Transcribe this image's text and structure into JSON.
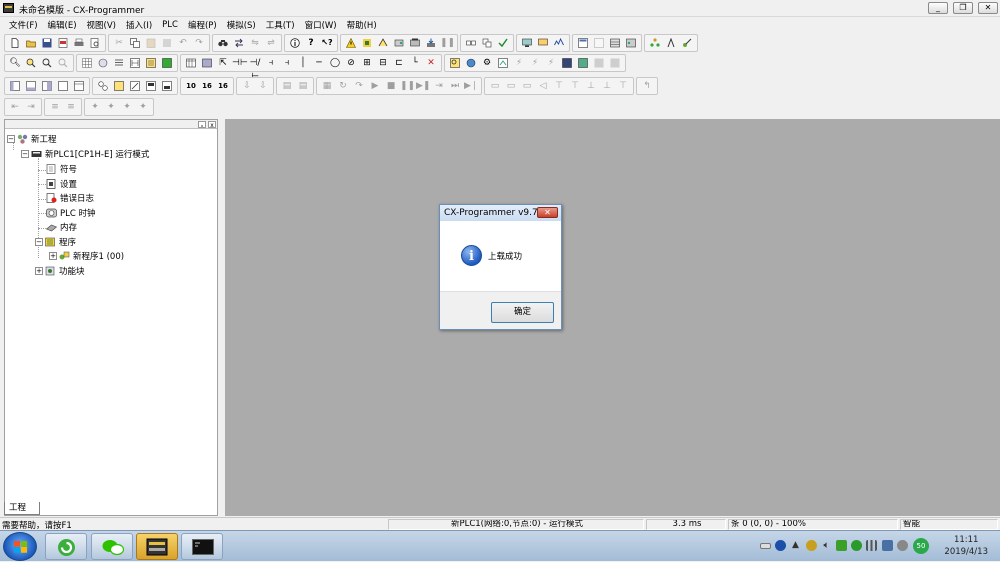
{
  "window": {
    "title": "未命名模版 - CX-Programmer",
    "controls": {
      "minimize": "_",
      "restore": "❐",
      "close": "✕"
    }
  },
  "menu": [
    "文件(F)",
    "编辑(E)",
    "视图(V)",
    "插入(I)",
    "PLC",
    "编程(P)",
    "模拟(S)",
    "工具(T)",
    "窗口(W)",
    "帮助(H)"
  ],
  "toolbar_numbers": [
    "10",
    "16",
    "16"
  ],
  "project": {
    "panel_controls": {
      "pin": "ₓ",
      "close": "x"
    },
    "tree": {
      "root": "新工程",
      "plc": "新PLC1[CP1H-E] 运行模式",
      "symbols": "符号",
      "settings": "设置",
      "error_log": "错误日志",
      "plc_clock": "PLC 时钟",
      "memory": "内存",
      "programs": "程序",
      "new_program": "新程序1 (00)",
      "function_blocks": "功能块",
      "expand_minus": "−",
      "expand_plus": "+"
    },
    "tab": "工程"
  },
  "dialog": {
    "title": "CX-Programmer v9.7",
    "close": "✕",
    "icon": "i",
    "message": "上载成功",
    "ok": "确定"
  },
  "status": {
    "help": "需要帮助，请按F1",
    "connection": "新PLC1(网络:0,节点:0) - 运行模式",
    "scan_time": "3.3 ms",
    "position": "条 0 (0, 0)  - 100%",
    "mode": "智能"
  },
  "taskbar": {
    "tray_badge": "50",
    "time": "11:11",
    "date": "2019/4/13"
  },
  "colors": {
    "workspace": "#ababab",
    "dialog_border": "#6a8fb8",
    "ok_border": "#3c7fb1",
    "taskbar": "#b4c8de"
  }
}
